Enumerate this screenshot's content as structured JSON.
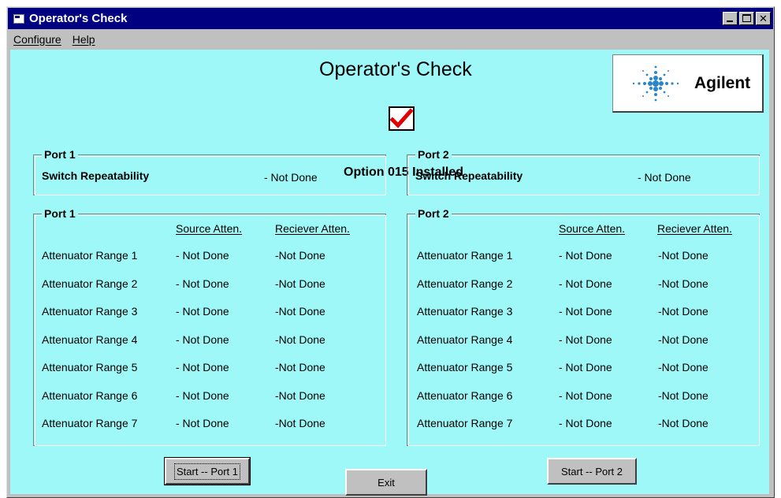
{
  "window": {
    "title": "Operator's Check",
    "controls": [
      "minimize-icon",
      "maximize-icon",
      "close-icon"
    ],
    "close_glyph": "✕",
    "colors": {
      "titlebar": "#000080",
      "client": "#9ff8f8",
      "face": "#c0c0c0"
    }
  },
  "menu": {
    "items": [
      {
        "label": "Configure"
      },
      {
        "label": "Help"
      }
    ]
  },
  "header": {
    "title": "Operator's Check",
    "option_text": "Option 015 Installed",
    "logo_text": "Agilent",
    "check_icon": "checkmark-icon"
  },
  "switch_groups": [
    {
      "title": "Port 1",
      "label": "Switch Repeatability",
      "status": "- Not Done"
    },
    {
      "title": "Port 2",
      "label": "Switch Repeatability",
      "status": "- Not Done"
    }
  ],
  "atten_groups": [
    {
      "title": "Port 1",
      "col_source": "Source Atten.",
      "col_receiver": "Reciever Atten.",
      "rows": [
        {
          "label": "Attenuator Range 1",
          "source": "- Not Done",
          "receiver": "-Not Done"
        },
        {
          "label": "Attenuator Range 2",
          "source": "- Not Done",
          "receiver": "-Not Done"
        },
        {
          "label": "Attenuator Range 3",
          "source": "- Not Done",
          "receiver": "-Not Done"
        },
        {
          "label": "Attenuator Range 4",
          "source": "- Not Done",
          "receiver": "-Not Done"
        },
        {
          "label": "Attenuator Range 5",
          "source": "- Not Done",
          "receiver": "-Not Done"
        },
        {
          "label": "Attenuator Range 6",
          "source": "- Not Done",
          "receiver": "-Not Done"
        },
        {
          "label": "Attenuator Range 7",
          "source": "- Not Done",
          "receiver": "-Not Done"
        }
      ]
    },
    {
      "title": "Port 2",
      "col_source": "Source Atten.",
      "col_receiver": "Reciever Atten.",
      "rows": [
        {
          "label": "Attenuator Range 1",
          "source": "- Not Done",
          "receiver": "-Not Done"
        },
        {
          "label": "Attenuator Range 2",
          "source": "- Not Done",
          "receiver": "-Not Done"
        },
        {
          "label": "Attenuator Range 3",
          "source": "- Not Done",
          "receiver": "-Not Done"
        },
        {
          "label": "Attenuator Range 4",
          "source": "- Not Done",
          "receiver": "-Not Done"
        },
        {
          "label": "Attenuator Range 5",
          "source": "- Not Done",
          "receiver": "-Not Done"
        },
        {
          "label": "Attenuator Range 6",
          "source": "- Not Done",
          "receiver": "-Not Done"
        },
        {
          "label": "Attenuator Range 7",
          "source": "- Not Done",
          "receiver": "-Not Done"
        }
      ]
    }
  ],
  "buttons": {
    "start_port1": "Start -- Port 1",
    "start_port2": "Start -- Port 2",
    "exit": "Exit"
  }
}
